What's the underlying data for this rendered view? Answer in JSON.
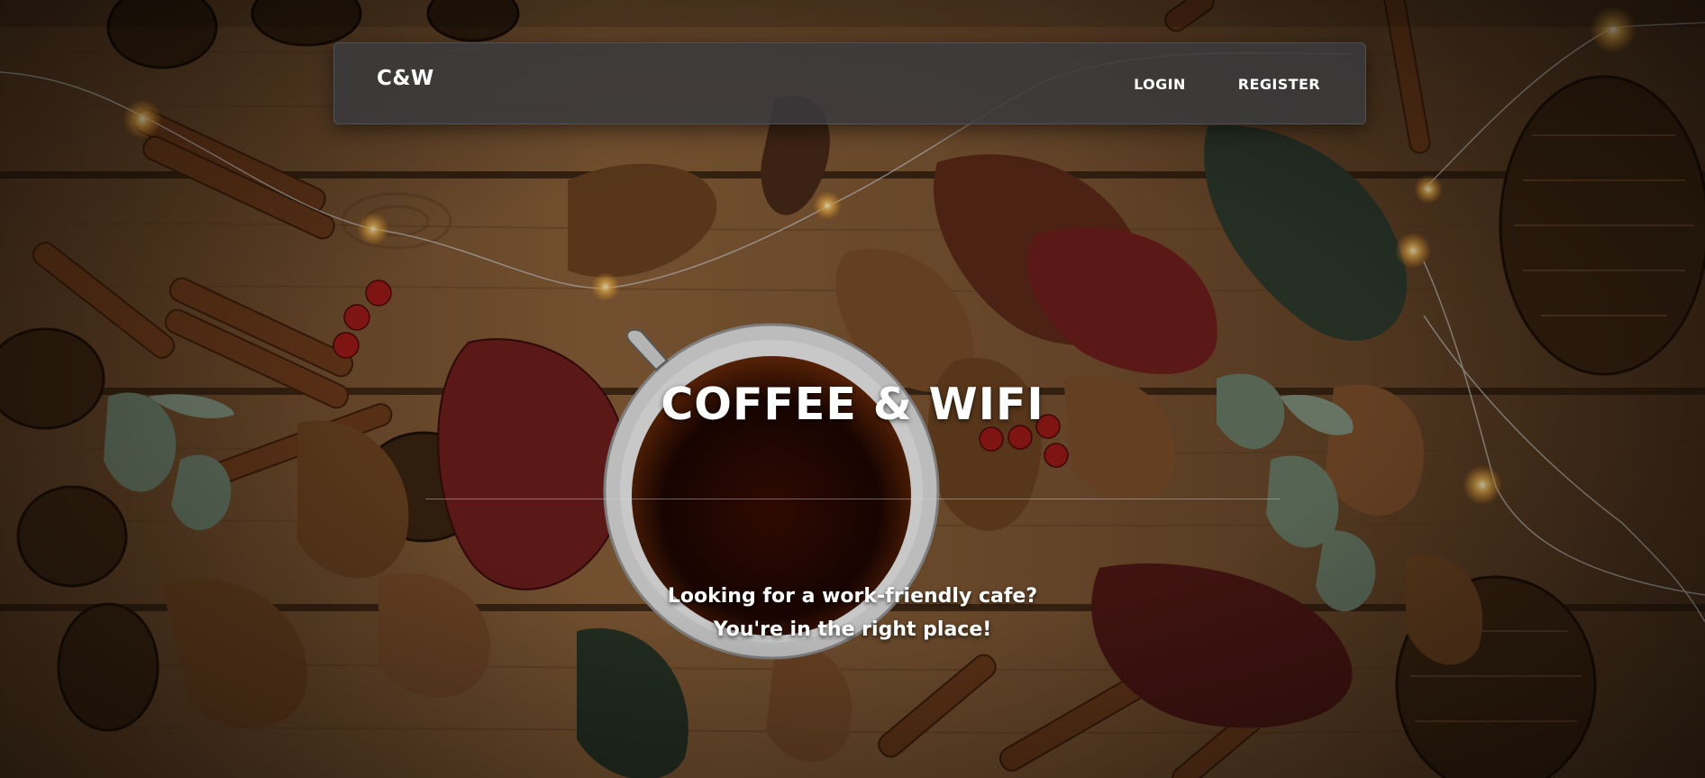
{
  "navbar": {
    "brand": "C&W",
    "links": [
      {
        "label": "LOGIN"
      },
      {
        "label": "REGISTER"
      }
    ]
  },
  "hero": {
    "title": "COFFEE & WIFI",
    "subtitle_line1": "Looking for a work-friendly cafe?",
    "subtitle_line2": "You're in the right place!"
  },
  "colors": {
    "navbar_bg": "#3a3a3e",
    "text": "#ffffff",
    "wood": "#8a5e33",
    "leaf_red": "#6e1e1c",
    "leaf_brown": "#6b4220",
    "leaf_green": "#3c4a38",
    "light_glow": "#ffd27a"
  },
  "icons": {
    "background": "coffee-cup-on-wood-background"
  }
}
